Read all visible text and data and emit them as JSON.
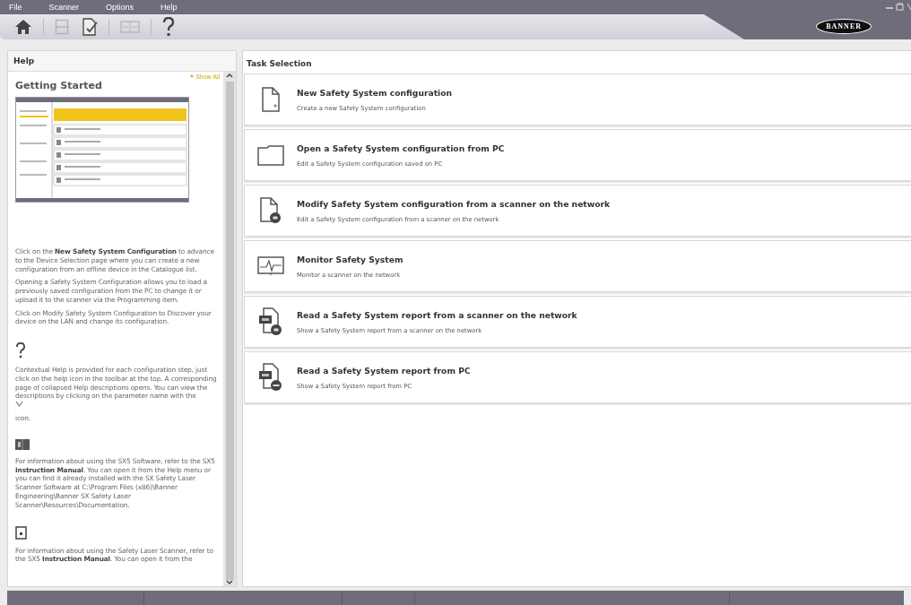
{
  "menu": [
    "File",
    "Scanner",
    "Options",
    "Help"
  ],
  "toolbar": [
    {
      "kind": "home",
      "disabled": false
    },
    {
      "kind": "save",
      "disabled": true
    },
    {
      "kind": "edit",
      "disabled": false
    },
    {
      "kind": "compare",
      "disabled": true
    },
    {
      "kind": "help",
      "disabled": false
    }
  ],
  "logo": "BANNER",
  "help": {
    "title": "Help",
    "show_all": "Show All",
    "heading": "Getting Started",
    "sections": [
      {
        "kind": "screenshot",
        "paragraphs": [
          "Click on the **New Safety System Configuration** to advance to the Device Selection page where you can create a new configuration from an offline device in the Catalogue list.",
          "Opening a Safety System Configuration allows you to load a previously saved configuration from the PC to change it or upload it to the scanner via the Programming item.",
          "Click on Modify Safety System Configuration to Discover your device on the LAN and change its configuration."
        ]
      },
      {
        "kind": "question",
        "paragraphs": [
          {
            "before": "Contextual Help is provided for each configuration step, just click on the help icon in the toolbar at the top. A corresponding page of collapsed Help descriptions opens. You can view the descriptions by clicking on the parameter name with the",
            "after": "icon."
          }
        ]
      },
      {
        "kind": "book",
        "paragraphs": [
          "For information about using the SX5 Software, refer to the SX5 **Instruction Manual**. You can open it from the Help menu or you can find it already installed with the SX Safety Laser Scanner Software at C:\\Program Files (x86)\\Banner Engineering\\Banner SX Safety Laser Scanner\\Resources\\Documentation."
        ]
      },
      {
        "kind": "document",
        "paragraphs": [
          "For information about using the Safety Laser Scanner, refer to the SX5 **Instruction Manual**. You can open it from the"
        ]
      }
    ]
  },
  "tasks": {
    "title": "Task Selection",
    "items": [
      {
        "kind": "new",
        "title": "New Safety System configuration",
        "description": "Create a new Safety System configuration"
      },
      {
        "kind": "open",
        "title": "Open a Safety System configuration from PC",
        "description": "Edit a Safety System configuration saved on PC"
      },
      {
        "kind": "modify",
        "title": "Modify Safety System configuration from a scanner on the network",
        "description": "Edit a Safety System configuration from a scanner on the network"
      },
      {
        "kind": "monitor",
        "title": "Monitor Safety System",
        "description": "Monitor a scanner on the network"
      },
      {
        "kind": "report-network",
        "title": "Read a Safety System report from a scanner on the network",
        "description": "Show a Safety System report from a scanner on the network"
      },
      {
        "kind": "report-pc",
        "title": "Read a Safety System report from PC",
        "description": "Show a Safety System report from PC"
      }
    ]
  }
}
